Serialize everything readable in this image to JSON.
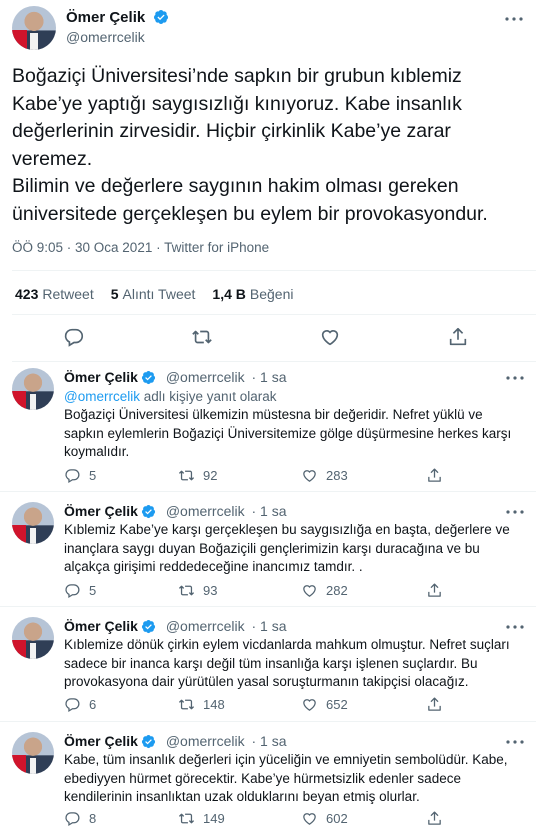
{
  "main_tweet": {
    "author_name": "Ömer Çelik",
    "handle": "@omerrcelik",
    "text": "Boğaziçi Üniversitesi’nde sapkın bir grubun kıblemiz\nKabe’ye yaptığı saygısızlığı kınıyoruz. Kabe insanlık\ndeğerlerinin zirvesidir. Hiçbir çirkinlik Kabe’ye zarar\nveremez.\nBilimin ve değerlere saygının hakim olması gereken\nüniversitede gerçekleşen bu eylem bir provokasyondur.",
    "timestamp": "ÖÖ 9:05 · 30 Oca 2021 · Twitter for iPhone",
    "stats": {
      "retweets_count": "423",
      "retweets_label": "Retweet",
      "quotes_count": "5",
      "quotes_label": "Alıntı Tweet",
      "likes_count": "1,4 B",
      "likes_label": "Beğeni"
    }
  },
  "replies": [
    {
      "author_name": "Ömer Çelik",
      "handle": "@omerrcelik",
      "time": "· 1 sa",
      "replying_handle": "@omerrcelik",
      "replying_suffix": " adlı kişiye yanıt olarak",
      "text": "Boğaziçi Üniversitesi ülkemizin müstesna bir değeridir. Nefret yüklü ve sapkın eylemlerin Boğaziçi Üniversitemize gölge düşürmesine herkes karşı koymalıdır.",
      "reply_count": "5",
      "retweet_count": "92",
      "like_count": "283"
    },
    {
      "author_name": "Ömer Çelik",
      "handle": "@omerrcelik",
      "time": "· 1 sa",
      "text": "Kıblemiz Kabe’ye karşı gerçekleşen bu saygısızlığa en başta, değerlere ve inançlara saygı duyan Boğaziçili gençlerimizin  karşı duracağına ve bu alçakça girişimi reddedeceğine inancımız tamdır. .",
      "reply_count": "5",
      "retweet_count": "93",
      "like_count": "282"
    },
    {
      "author_name": "Ömer Çelik",
      "handle": "@omerrcelik",
      "time": "· 1 sa",
      "text": "Kıblemize dönük çirkin eylem vicdanlarda  mahkum olmuştur. Nefret suçları sadece bir inanca karşı değil tüm insanlığa karşı işlenen suçlardır. Bu provokasyona dair yürütülen yasal soruşturmanın takipçisi olacağız.",
      "reply_count": "6",
      "retweet_count": "148",
      "like_count": "652"
    },
    {
      "author_name": "Ömer Çelik",
      "handle": "@omerrcelik",
      "time": "· 1 sa",
      "text": "Kabe, tüm insanlık değerleri için yüceliğin ve emniyetin sembolüdür. Kabe, ebediyyen hürmet görecektir. Kabe’ye hürmetsizlik edenler sadece kendilerinin insanlıktan uzak olduklarını beyan etmiş olurlar.",
      "reply_count": "8",
      "retweet_count": "149",
      "like_count": "602"
    }
  ],
  "colors": {
    "accent": "#1d9bf0",
    "secondary_text": "#536471",
    "divider": "#eff3f4"
  },
  "icons": [
    "verified-badge-icon",
    "more-icon",
    "reply-icon",
    "retweet-icon",
    "like-icon",
    "share-icon"
  ]
}
